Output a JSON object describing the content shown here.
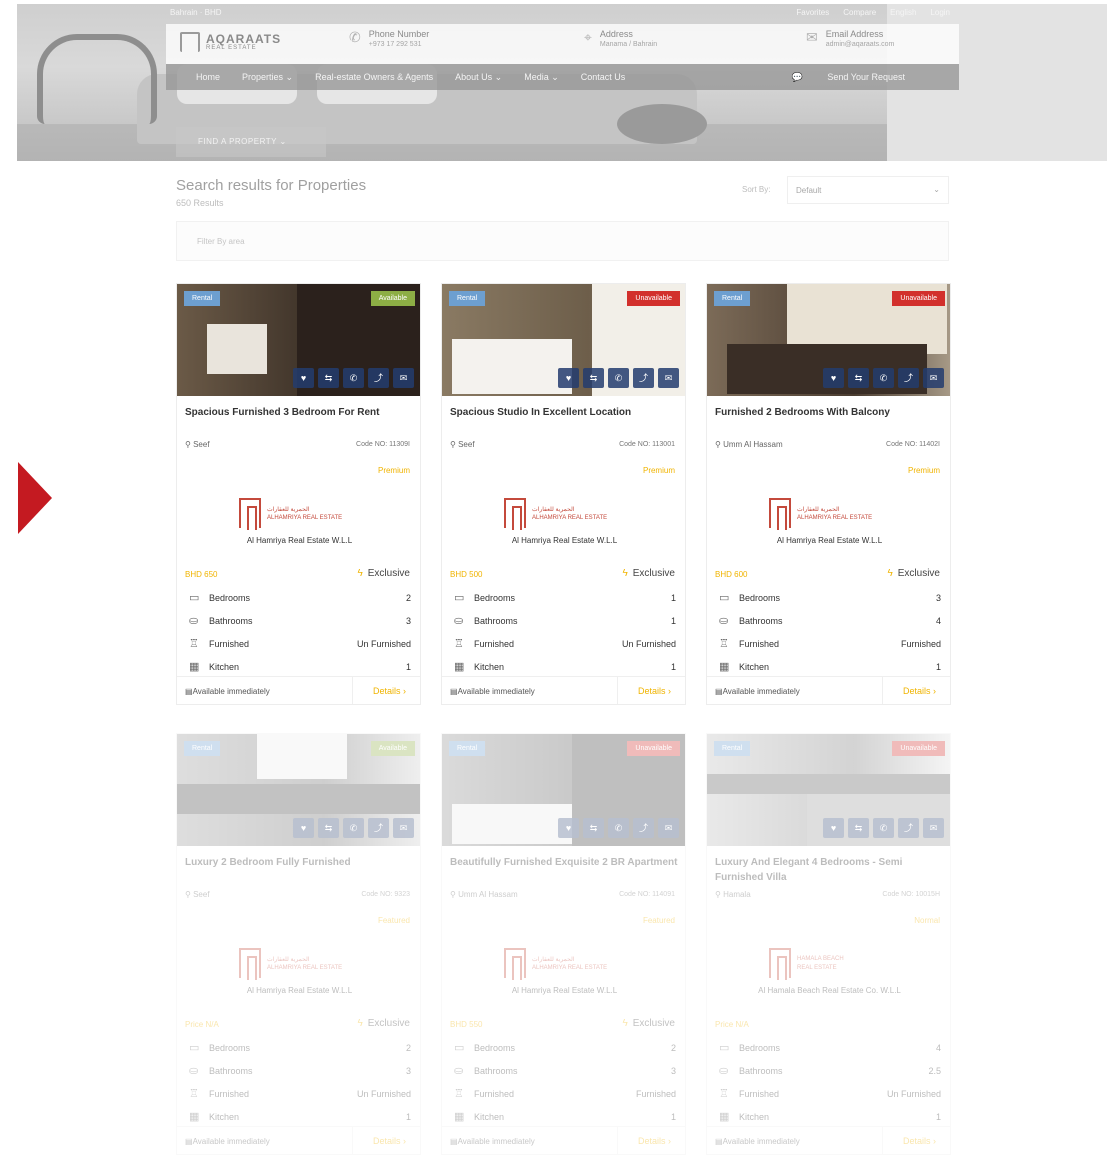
{
  "topbar": {
    "lang": "Bahrain · BHD",
    "links": [
      "Favorites",
      "Compare",
      "English",
      "Login"
    ]
  },
  "header": {
    "logo_name": "AQARAATS",
    "logo_sub": "REAL ESTATE",
    "contacts": [
      {
        "label": "Phone Number",
        "value": "+973 17 292 531",
        "icon": "phone-icon"
      },
      {
        "label": "Address",
        "value": "Manama / Bahrain",
        "icon": "location-pin-icon"
      },
      {
        "label": "Email Address",
        "value": "admin@aqaraats.com",
        "icon": "envelope-icon"
      }
    ]
  },
  "nav": {
    "items": [
      "Home",
      "Properties ⌄",
      "Real-estate Owners & Agents",
      "About Us ⌄",
      "Media ⌄",
      "Contact Us"
    ],
    "request": "Send Your Request"
  },
  "find_tab": "FIND A PROPERTY  ⌄",
  "results": {
    "title": "Search results for Properties",
    "count": "650 Results"
  },
  "sort": {
    "label": "Sort By:",
    "value": "Default"
  },
  "filter": {
    "placeholder": "Filter By area"
  },
  "feature_labels": [
    "Bedrooms",
    "Bathrooms",
    "Furnished",
    "Kitchen"
  ],
  "cards": [
    {
      "type": "Rental",
      "status": "Available",
      "status_color": "#8dae45",
      "title": "Spacious Furnished 3 Bedroom For Rent",
      "location": "Seef",
      "code": "Code NO: 11309I",
      "badge": "Premium",
      "agency": "Al Hamriya Real Estate W.L.L",
      "agency_t1": "الحمرية للعقارات",
      "agency_t2": "ALHAMRIYA REAL ESTATE",
      "price": "BHD 650",
      "exclusive": "Exclusive",
      "bedrooms": "2",
      "bathrooms": "3",
      "furnished": "Un Furnished",
      "kitchen": "1",
      "availability": "Available immediately",
      "details": "Details ›"
    },
    {
      "type": "Rental",
      "status": "Unavailable",
      "status_color": "#d2302c",
      "title": "Spacious Studio In Excellent Location",
      "location": "Seef",
      "code": "Code NO: 113001",
      "badge": "Premium",
      "agency": "Al Hamriya Real Estate W.L.L",
      "agency_t1": "الحمرية للعقارات",
      "agency_t2": "ALHAMRIYA REAL ESTATE",
      "price": "BHD 500",
      "exclusive": "Exclusive",
      "bedrooms": "1",
      "bathrooms": "1",
      "furnished": "Un Furnished",
      "kitchen": "1",
      "availability": "Available immediately",
      "details": "Details ›"
    },
    {
      "type": "Rental",
      "status": "Unavailable",
      "status_color": "#d2302c",
      "title": "Furnished 2 Bedrooms With Balcony",
      "location": "Umm Al Hassam",
      "code": "Code NO: 11402I",
      "badge": "Premium",
      "agency": "Al Hamriya Real Estate W.L.L",
      "agency_t1": "الحمرية للعقارات",
      "agency_t2": "ALHAMRIYA REAL ESTATE",
      "price": "BHD 600",
      "exclusive": "Exclusive",
      "bedrooms": "3",
      "bathrooms": "4",
      "furnished": "Furnished",
      "kitchen": "1",
      "availability": "Available immediately",
      "details": "Details ›"
    },
    {
      "type": "Rental",
      "status": "Available",
      "status_color": "#8dae45",
      "title": "Luxury 2 Bedroom Fully Furnished",
      "location": "Seef",
      "code": "Code NO: 9323",
      "badge": "Featured",
      "agency": "Al Hamriya Real Estate W.L.L",
      "agency_t1": "الحمرية للعقارات",
      "agency_t2": "ALHAMRIYA REAL ESTATE",
      "price": "Price N/A",
      "exclusive": "Exclusive",
      "bedrooms": "2",
      "bathrooms": "3",
      "furnished": "Un Furnished",
      "kitchen": "1",
      "availability": "Available immediately",
      "details": "Details ›"
    },
    {
      "type": "Rental",
      "status": "Unavailable",
      "status_color": "#d2302c",
      "title": "Beautifully Furnished Exquisite 2 BR Apartment",
      "location": "Umm Al Hassam",
      "code": "Code NO: 114091",
      "badge": "Featured",
      "agency": "Al Hamriya Real Estate W.L.L",
      "agency_t1": "الحمرية للعقارات",
      "agency_t2": "ALHAMRIYA REAL ESTATE",
      "price": "BHD 550",
      "exclusive": "Exclusive",
      "bedrooms": "2",
      "bathrooms": "3",
      "furnished": "Furnished",
      "kitchen": "1",
      "availability": "Available immediately",
      "details": "Details ›"
    },
    {
      "type": "Rental",
      "status": "Unavailable",
      "status_color": "#d2302c",
      "title": "Luxury And Elegant 4 Bedrooms - Semi Furnished Villa",
      "location": "Hamala",
      "code": "Code NO: 10015H",
      "badge": "Normal",
      "agency": "Al Hamala Beach Real Estate Co. W.L.L",
      "agency_t1": "HAMALA BEACH",
      "agency_t2": "REAL ESTATE",
      "price": "Price N/A",
      "exclusive": "",
      "bedrooms": "4",
      "bathrooms": "2.5",
      "furnished": "Un Furnished",
      "kitchen": "1",
      "availability": "Available immediately",
      "details": "Details ›"
    }
  ]
}
